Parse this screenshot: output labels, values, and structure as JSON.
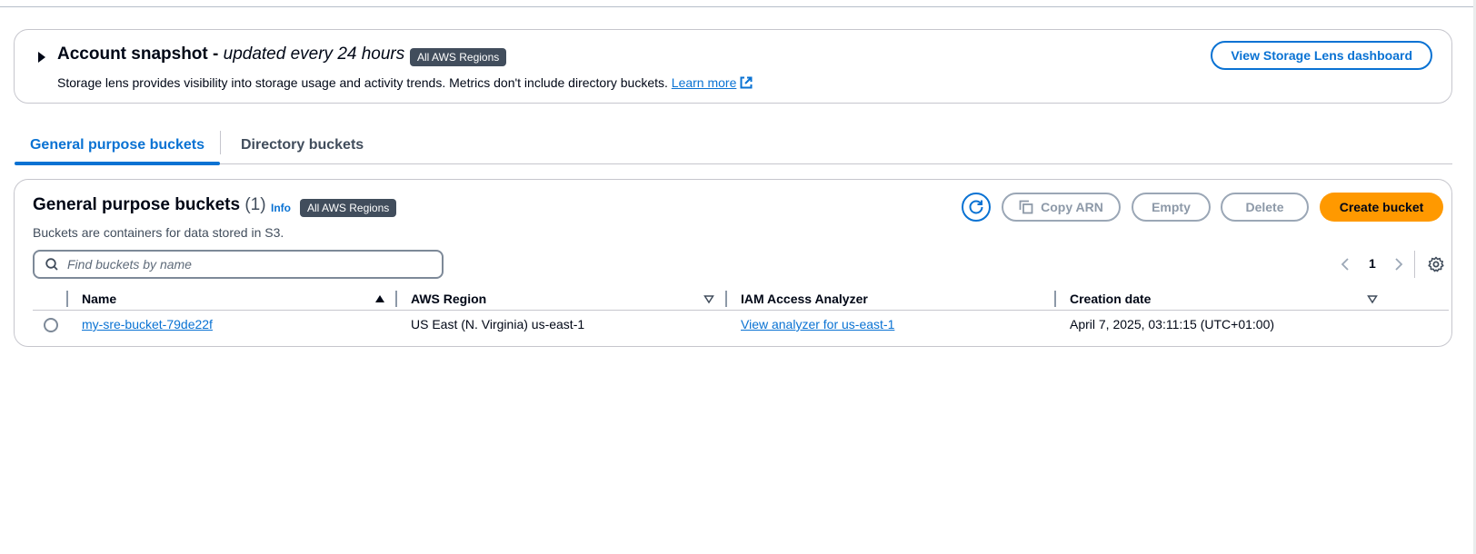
{
  "snapshot": {
    "title": "Account snapshot - ",
    "subtitle": "updated every 24 hours",
    "badge": "All AWS Regions",
    "description": "Storage lens provides visibility into storage usage and activity trends. Metrics don't include directory buckets. ",
    "learn_more": "Learn more",
    "dashboard_button": "View Storage Lens dashboard"
  },
  "tabs": [
    {
      "label": "General purpose buckets",
      "active": true
    },
    {
      "label": "Directory buckets",
      "active": false
    }
  ],
  "buckets": {
    "title": "General purpose buckets",
    "count": "(1)",
    "info": "Info",
    "badge": "All AWS Regions",
    "description": "Buckets are containers for data stored in S3.",
    "buttons": {
      "copy_arn": "Copy ARN",
      "empty": "Empty",
      "delete": "Delete",
      "create": "Create bucket"
    },
    "search_placeholder": "Find buckets by name",
    "page": "1",
    "columns": [
      "Name",
      "AWS Region",
      "IAM Access Analyzer",
      "Creation date"
    ],
    "rows": [
      {
        "name": "my-sre-bucket-79de22f",
        "region": "US East (N. Virginia) us-east-1",
        "analyzer": "View analyzer for us-east-1",
        "created": "April 7, 2025, 03:11:15 (UTC+01:00)"
      }
    ]
  },
  "colors": {
    "accent": "#0972d3",
    "primary_button": "#ff9900",
    "badge": "#414d5c",
    "disabled": "#8d99a8"
  },
  "icons": [
    "caret-right-icon",
    "external-link-icon",
    "refresh-icon",
    "copy-icon",
    "search-icon",
    "chevron-left-icon",
    "chevron-right-icon",
    "settings-icon",
    "sort-ascending-icon",
    "sort-descending-icon"
  ]
}
